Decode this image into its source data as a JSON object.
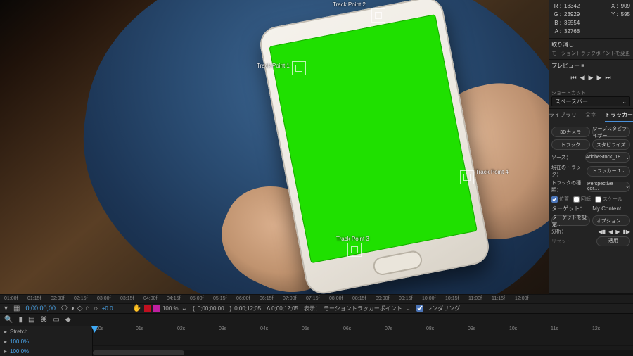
{
  "info": {
    "R": "18342",
    "G": "23929",
    "B": "35554",
    "A": "32768",
    "X": "909",
    "Y": "595",
    "undo_title": "取り消し",
    "undo_action": "モーショントラックポイントを変更"
  },
  "preview": {
    "title": "プレビュー ≡"
  },
  "shortcut": {
    "label": "ショートカット",
    "value": "スペースバー"
  },
  "tabs": {
    "library": "ライブラリ",
    "text": "文字",
    "tracker": "トラッカー"
  },
  "tracker": {
    "btn_3dcam": "3Dカメラ",
    "btn_warp": "ワープスタビライザー",
    "btn_track": "トラック",
    "btn_stab": "スタビライズ",
    "source_k": "ソース：",
    "source_v": "AdobeStock_18…",
    "current_k": "現在のトラック：",
    "current_v": "トラッカー 1",
    "type_k": "トラックの種類：",
    "type_v": "Perspective cor…",
    "ck_pos": "位置",
    "ck_rot": "回転",
    "ck_scale": "スケール",
    "target_k": "ターゲット：",
    "target_v": "My Content",
    "btn_target": "ターゲットを設定…",
    "btn_options": "オプション…",
    "analyze": "分析：",
    "reset": "リセット",
    "apply": "適用"
  },
  "track_points": {
    "p1": "Track Point 1",
    "p2": "Track Point 2",
    "p3": "Track Point 3",
    "p4": "Track Point 4"
  },
  "ruler": [
    "01;00f",
    "01;15f",
    "02;00f",
    "02;15f",
    "03;00f",
    "03;15f",
    "04;00f",
    "04;15f",
    "05;00f",
    "05;15f",
    "06;00f",
    "06;15f",
    "07;00f",
    "07;15f",
    "08;00f",
    "08;15f",
    "09;00f",
    "09;15f",
    "10;00f",
    "10;15f",
    "11;00f",
    "11;15f",
    "12;00f"
  ],
  "ctrl": {
    "timecode": "0;00;00;00",
    "zoom": "100 %",
    "cur": "0;00;00;00",
    "dur": "0;00;12;05",
    "delta": "Δ 0;00;12;05",
    "display_k": "表示：",
    "display_v": "モーショントラッカーポイント",
    "render": "レンダリング",
    "plus": "+0.0"
  },
  "timeline": {
    "stretch": "Stretch",
    "val1": "100.0%",
    "val2": "100.0%",
    "ticks": [
      ":00s",
      "01s",
      "02s",
      "03s",
      "04s",
      "05s",
      "06s",
      "07s",
      "08s",
      "09s",
      "10s",
      "11s",
      "12s"
    ]
  }
}
